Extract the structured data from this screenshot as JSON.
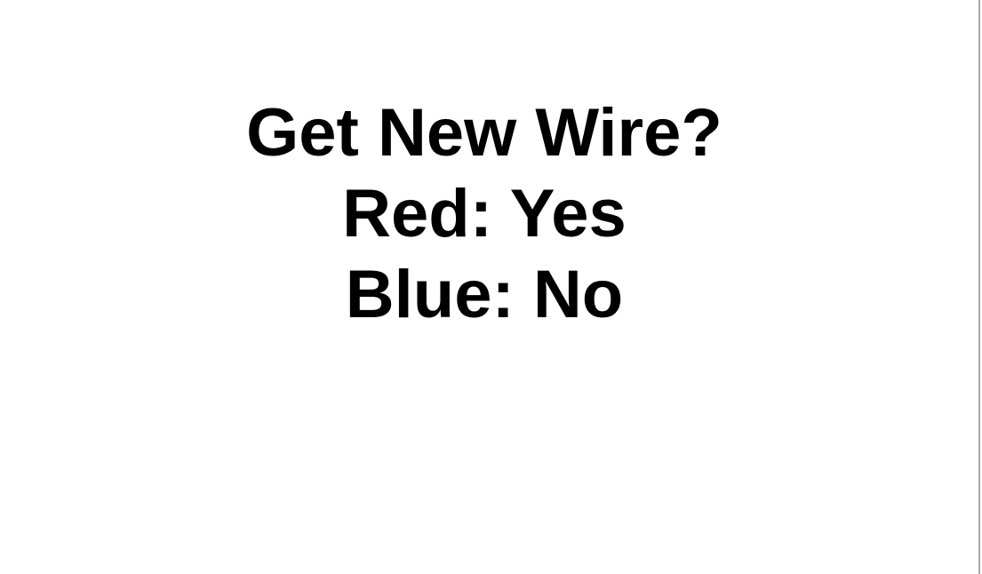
{
  "prompt": {
    "question": "Get New Wire?",
    "option_red": "Red: Yes",
    "option_blue": "Blue: No"
  },
  "colors": {
    "background": "#ffffff",
    "text": "#000000",
    "edge": "#a9a9a9"
  }
}
